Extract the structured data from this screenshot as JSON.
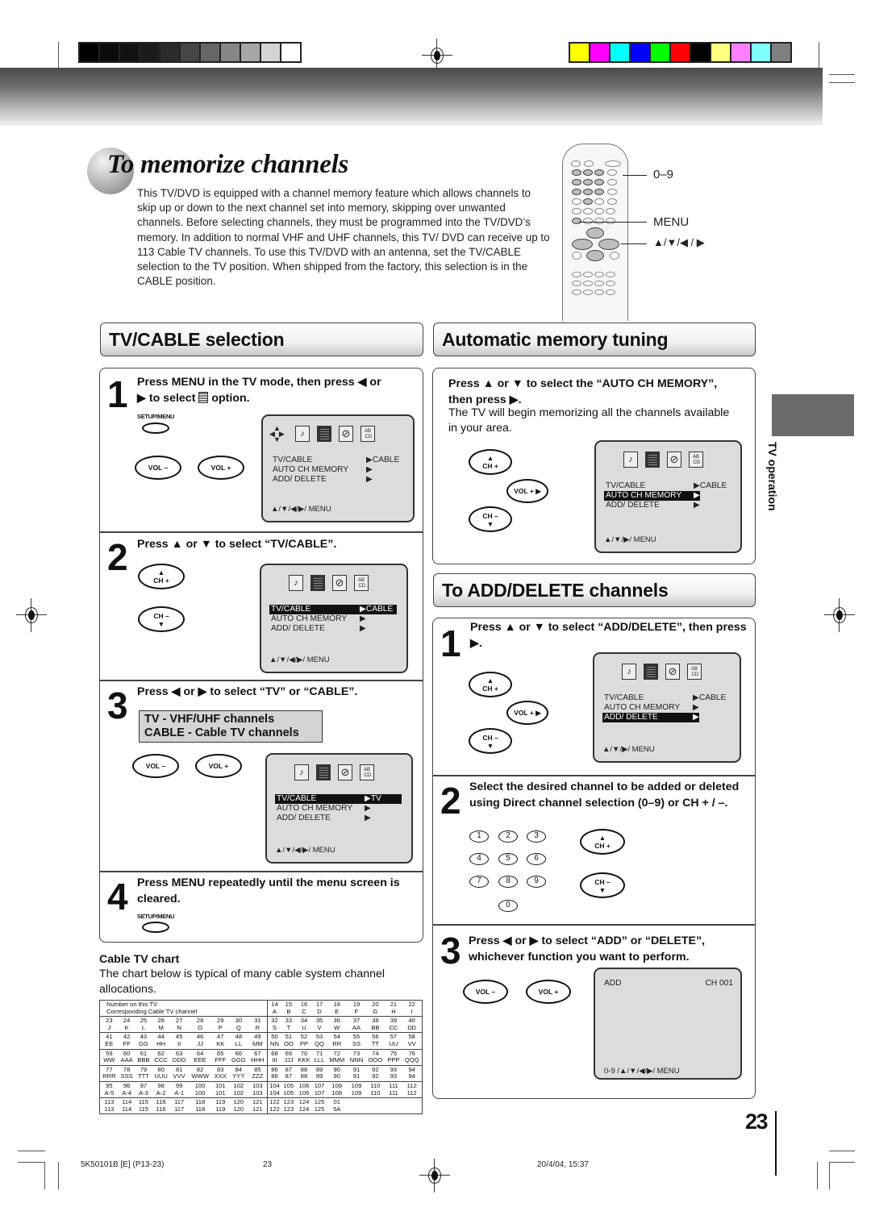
{
  "print_marks": {
    "gray_swatches": [
      "#000000",
      "#0b0b0b",
      "#111111",
      "#1b1b1b",
      "#2b2b2b",
      "#464646",
      "#666666",
      "#868686",
      "#a6a6a6",
      "#d4d4d4",
      "#ffffff"
    ],
    "color_swatches": [
      "#ffff00",
      "#ff00ff",
      "#00ffff",
      "#0000ff",
      "#00ff00",
      "#ff0000",
      "#000000",
      "#ffff80",
      "#ff80ff",
      "#80ffff",
      "#808080"
    ]
  },
  "title": {
    "prefix": "To",
    "rest": "memorize channels"
  },
  "intro": "This TV/DVD is equipped with a channel memory feature which allows channels to skip up or down to the next channel set into memory, skipping over unwanted channels. Before selecting channels, they must be programmed into the TV/DVD’s memory. In addition to normal VHF and UHF channels, this TV/ DVD can receive up to 113 Cable TV channels. To use this TV/DVD with an antenna, set the TV/CABLE selection to the TV position. When shipped from the factory, this selection is in the CABLE position.",
  "remote_labels": {
    "digits": "0–9",
    "menu": "MENU",
    "arrows": "▲/▼/◀ / ▶"
  },
  "osd_common": {
    "rows": [
      "TV/CABLE",
      "AUTO  CH  MEMORY",
      "ADD/ DELETE"
    ],
    "arrow": "▶",
    "icons": [
      "picture-icon",
      "setup-grid-icon",
      "lock-icon",
      "language-icon"
    ],
    "lang_icon_text": "AB\nCD",
    "footer_full": "▲/▼/◀/▶/ MENU",
    "footer_short": "▲/▼/▶/ MENU"
  },
  "buttons": {
    "setup_menu": "SETUP/MENU",
    "vol_minus": "VOL –",
    "vol_plus": "VOL +",
    "ch_plus": "CH +",
    "ch_minus": "CH –"
  },
  "tv_cable": {
    "heading": "TV/CABLE selection",
    "steps": [
      {
        "num": "1",
        "text_a": "Press MENU in the TV mode, then press ◀ or",
        "text_b": "▶ to select",
        "text_c": "option.",
        "osd_value": "CABLE",
        "selected_row": -1
      },
      {
        "num": "2",
        "text": "Press ▲ or ▼ to select “TV/CABLE”.",
        "osd_value": "CABLE",
        "selected_row": 0
      },
      {
        "num": "3",
        "text": "Press ◀ or ▶ to select “TV” or “CABLE”.",
        "note_1": "TV - VHF/UHF channels",
        "note_2": "CABLE - Cable TV channels",
        "osd_value": "TV",
        "selected_row": 0
      },
      {
        "num": "4",
        "text": "Press MENU repeatedly until the menu screen is cleared."
      }
    ]
  },
  "auto_memory": {
    "heading": "Automatic memory tuning",
    "text_bold_1": "Press ▲ or ▼ to select the “AUTO CH MEMORY”,",
    "text_bold_2": "then press ▶.",
    "text_plain": "The TV will begin memorizing all the channels available in your area.",
    "osd_value": "CABLE",
    "selected_row": 1
  },
  "add_delete": {
    "heading": "To ADD/DELETE channels",
    "steps": [
      {
        "num": "1",
        "text": "Press ▲ or ▼ to select “ADD/DELETE”, then press ▶.",
        "osd_value": "CABLE",
        "selected_row": 2
      },
      {
        "num": "2",
        "text": "Select the desired channel to be added or deleted using Direct channel selection (0–9) or CH + / –.",
        "digits": [
          "1",
          "2",
          "3",
          "4",
          "5",
          "6",
          "7",
          "8",
          "9",
          "0"
        ]
      },
      {
        "num": "3",
        "text": "Press ◀ or ▶ to select “ADD” or “DELETE”, whichever function you want to perform.",
        "osd_mode": "ADD",
        "osd_channel": "CH 001",
        "osd_footer": "0-9 /▲/▼/◀/▶/ MENU"
      }
    ]
  },
  "cable_chart": {
    "heading": "Cable TV chart",
    "description": "The chart below is typical of many cable system channel allocations.",
    "header_label_1": "Number on this TV",
    "header_label_2": "Corresponding Cable TV channel",
    "header_tv": [
      "14",
      "15",
      "16",
      "17",
      "18",
      "19",
      "20",
      "21",
      "22"
    ],
    "header_cable": [
      "A",
      "B",
      "C",
      "D",
      "E",
      "F",
      "G",
      "H",
      "I"
    ],
    "rows": [
      {
        "tv": [
          "23",
          "24",
          "25",
          "26",
          "27",
          "28",
          "29",
          "30",
          "31",
          "32",
          "33",
          "34",
          "35",
          "36",
          "37",
          "38",
          "39",
          "40"
        ],
        "cable": [
          "J",
          "K",
          "L",
          "M",
          "N",
          "O",
          "P",
          "Q",
          "R",
          "S",
          "T",
          "U",
          "V",
          "W",
          "AA",
          "BB",
          "CC",
          "DD"
        ]
      },
      {
        "tv": [
          "41",
          "42",
          "43",
          "44",
          "45",
          "46",
          "47",
          "48",
          "49",
          "50",
          "51",
          "52",
          "53",
          "54",
          "55",
          "56",
          "57",
          "58"
        ],
        "cable": [
          "EE",
          "FF",
          "GG",
          "HH",
          "II",
          "JJ",
          "KK",
          "LL",
          "MM",
          "NN",
          "OO",
          "PP",
          "QQ",
          "RR",
          "SS",
          "TT",
          "UU",
          "VV"
        ]
      },
      {
        "tv": [
          "59",
          "60",
          "61",
          "62",
          "63",
          "64",
          "65",
          "66",
          "67",
          "68",
          "69",
          "70",
          "71",
          "72",
          "73",
          "74",
          "75",
          "76"
        ],
        "cable": [
          "WW",
          "AAA",
          "BBB",
          "CCC",
          "DDD",
          "EEE",
          "FFF",
          "GGG",
          "HHH",
          "III",
          "JJJ",
          "KKK",
          "LLL",
          "MMM",
          "NNN",
          "OOO",
          "PPP",
          "QQQ"
        ]
      },
      {
        "tv": [
          "77",
          "78",
          "79",
          "80",
          "81",
          "82",
          "83",
          "84",
          "85",
          "86",
          "87",
          "88",
          "89",
          "90",
          "91",
          "92",
          "93",
          "94"
        ],
        "cable": [
          "RRR",
          "SSS",
          "TTT",
          "UUU",
          "VVV",
          "WWW",
          "XXX",
          "YYY",
          "ZZZ",
          "86",
          "87",
          "88",
          "89",
          "90",
          "91",
          "92",
          "93",
          "94"
        ]
      },
      {
        "tv": [
          "95",
          "96",
          "97",
          "98",
          "99",
          "100",
          "101",
          "102",
          "103",
          "104",
          "105",
          "106",
          "107",
          "108",
          "109",
          "110",
          "111",
          "112"
        ],
        "cable": [
          "A-5",
          "A-4",
          "A-3",
          "A-2",
          "A-1",
          "100",
          "101",
          "102",
          "103",
          "104",
          "105",
          "106",
          "107",
          "108",
          "109",
          "110",
          "111",
          "112"
        ]
      },
      {
        "tv": [
          "113",
          "114",
          "115",
          "116",
          "117",
          "118",
          "119",
          "120",
          "121",
          "122",
          "123",
          "124",
          "125",
          "01",
          "",
          "",
          "",
          ""
        ],
        "cable": [
          "113",
          "114",
          "115",
          "116",
          "117",
          "118",
          "119",
          "120",
          "121",
          "122",
          "123",
          "124",
          "125",
          "5A",
          "",
          "",
          "",
          ""
        ]
      }
    ]
  },
  "side_tab": "TV operation",
  "page_number": "23",
  "footer": {
    "job": "5K50101B [E] (P13-23)",
    "page": "23",
    "date": "20/4/04, 15:37"
  }
}
